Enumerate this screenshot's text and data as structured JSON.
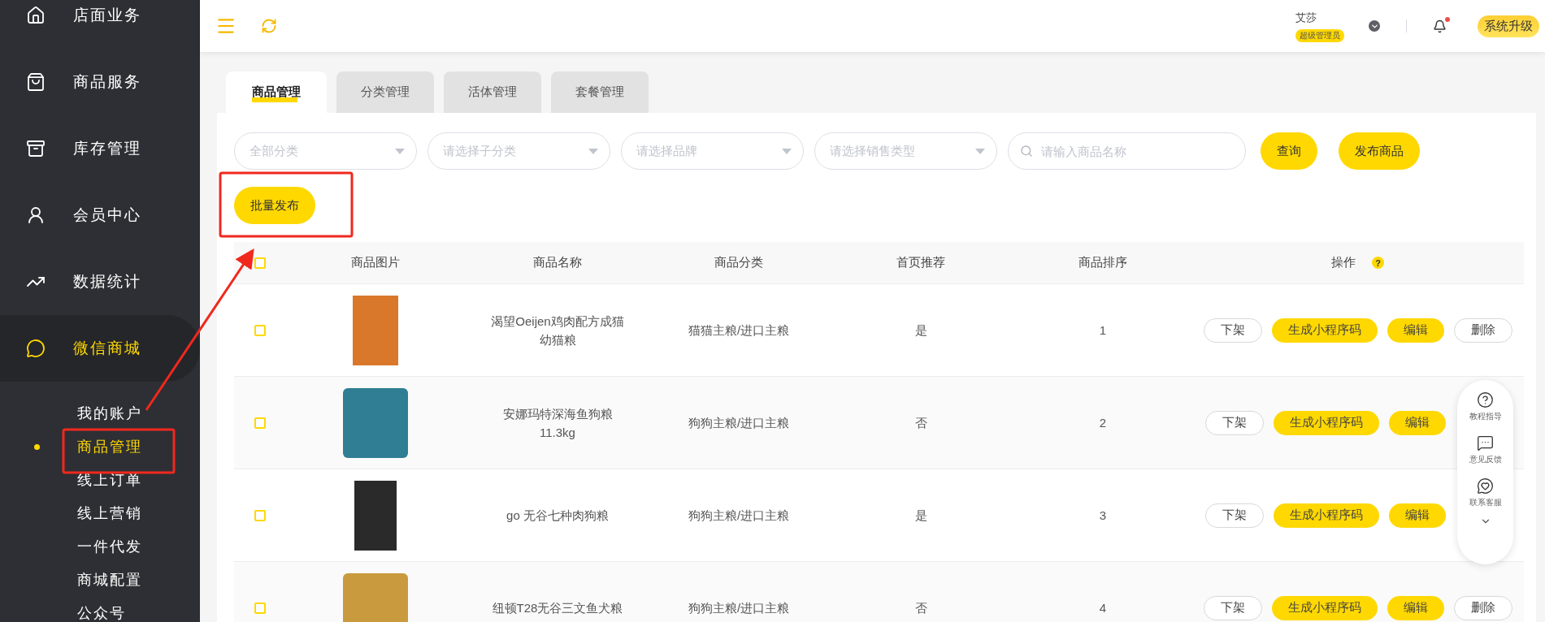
{
  "sidebar": {
    "items": [
      {
        "label": "店面业务",
        "selected": false
      },
      {
        "label": "商品服务",
        "selected": false
      },
      {
        "label": "库存管理",
        "selected": false
      },
      {
        "label": "会员中心",
        "selected": false
      },
      {
        "label": "数据统计",
        "selected": false
      },
      {
        "label": "微信商城",
        "selected": true
      }
    ],
    "sub_items": [
      {
        "label": "我的账户",
        "selected": false
      },
      {
        "label": "商品管理",
        "selected": true
      },
      {
        "label": "线上订单",
        "selected": false
      },
      {
        "label": "线上营销",
        "selected": false
      },
      {
        "label": "一件代发",
        "selected": false
      },
      {
        "label": "商城配置",
        "selected": false
      },
      {
        "label": "公众号",
        "selected": false
      }
    ]
  },
  "header": {
    "user_name": "艾莎",
    "role_badge": "超级管理员",
    "notification_unread": true,
    "upgrade_button": "系统升级"
  },
  "tabs": [
    {
      "label": "商品管理",
      "selected": true
    },
    {
      "label": "分类管理",
      "selected": false
    },
    {
      "label": "活体管理",
      "selected": false
    },
    {
      "label": "套餐管理",
      "selected": false
    }
  ],
  "filters": [
    {
      "placeholder": "全部分类"
    },
    {
      "placeholder": "请选择子分类"
    },
    {
      "placeholder": "请选择品牌"
    },
    {
      "placeholder": "请选择销售类型"
    }
  ],
  "search": {
    "placeholder": "请输入商品名称"
  },
  "buttons": [
    "查询",
    "发布商品"
  ],
  "batch_button": "批量发布",
  "table": {
    "select_all_checked": false,
    "columns": [
      "商品图片",
      "商品名称",
      "商品分类",
      "首页推荐",
      "商品排序",
      "操作"
    ],
    "help_mark": "?",
    "rows": [
      {
        "checked": false,
        "name": "渴望Oeijen鸡肉配方成猫幼猫粮",
        "category": "猫猫主粮/进口主粮",
        "recommended": "是",
        "sort": "1",
        "actions": [
          {
            "label": "下架",
            "kind": "outline"
          },
          {
            "label": "生成小程序码",
            "kind": "primary"
          },
          {
            "label": "编辑",
            "kind": "primary"
          },
          {
            "label": "删除",
            "kind": "outline"
          }
        ]
      },
      {
        "checked": false,
        "name": "安娜玛特深海鱼狗粮11.3kg",
        "category": "狗狗主粮/进口主粮",
        "recommended": "否",
        "sort": "2",
        "actions": [
          {
            "label": "下架",
            "kind": "outline"
          },
          {
            "label": "生成小程序码",
            "kind": "primary"
          },
          {
            "label": "编辑",
            "kind": "primary"
          }
        ]
      },
      {
        "checked": false,
        "name": "go 无谷七种肉狗粮",
        "category": "狗狗主粮/进口主粮",
        "recommended": "是",
        "sort": "3",
        "actions": [
          {
            "label": "下架",
            "kind": "outline"
          },
          {
            "label": "生成小程序码",
            "kind": "primary"
          },
          {
            "label": "编辑",
            "kind": "primary"
          }
        ]
      },
      {
        "checked": false,
        "name": "纽顿T28无谷三文鱼犬粮",
        "category": "狗狗主粮/进口主粮",
        "recommended": "否",
        "sort": "4",
        "actions": [
          {
            "label": "下架",
            "kind": "outline"
          },
          {
            "label": "生成小程序码",
            "kind": "primary"
          },
          {
            "label": "编辑",
            "kind": "primary"
          },
          {
            "label": "删除",
            "kind": "outline"
          }
        ]
      }
    ]
  },
  "float_panel": {
    "items": [
      {
        "label": "教程指导"
      },
      {
        "label": "意见反馈"
      },
      {
        "label": "联系客服"
      }
    ]
  }
}
